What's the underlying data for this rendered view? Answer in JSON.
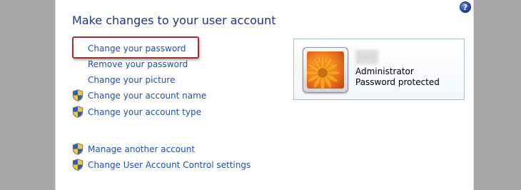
{
  "help": {
    "glyph": "?"
  },
  "page": {
    "title": "Make changes to your user account"
  },
  "tasks": [
    "Change your password",
    "Remove your password",
    "Change your picture",
    "Change your account name",
    "Change your account type"
  ],
  "other_tasks": [
    "Manage another account",
    "Change User Account Control settings"
  ],
  "account": {
    "type": "Administrator",
    "status": "Password protected"
  },
  "colors": {
    "title": "#1e3287",
    "link": "#1e4fb0",
    "highlight_border": "#a03030",
    "outer_background": "#a8a8a8"
  },
  "icons": {
    "help": "help-icon",
    "shield": "uac-shield-icon",
    "avatar": "flower-avatar"
  }
}
